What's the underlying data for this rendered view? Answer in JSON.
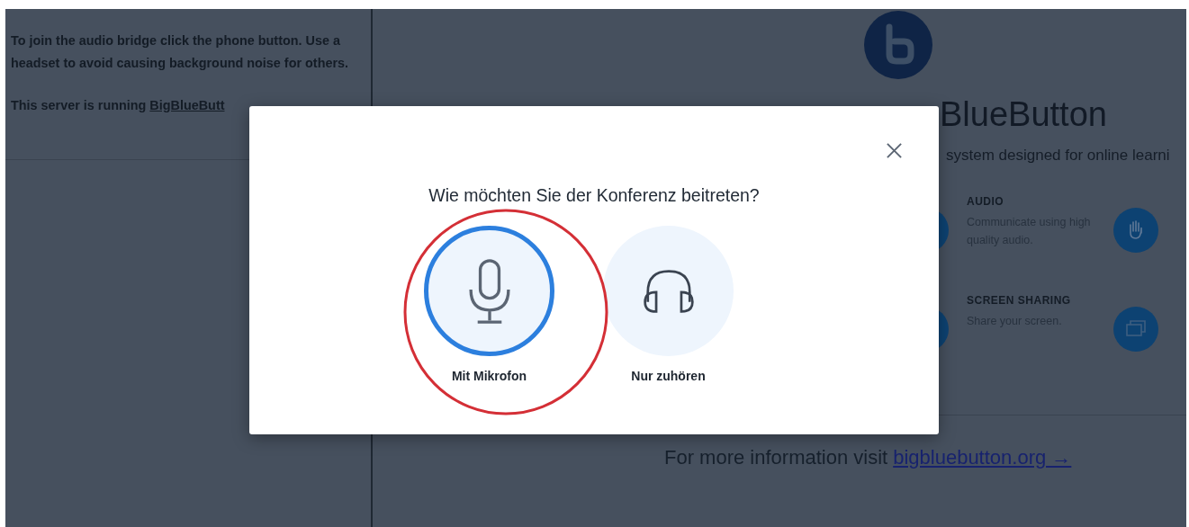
{
  "sidebar": {
    "paragraphs": [
      "To join the audio bridge click the phone button. Use a headset to avoid causing background noise for others."
    ],
    "server_text": "This server is running",
    "server_link": "BigBlueButt"
  },
  "welcome": {
    "title": "BlueButton",
    "subtitle": "system designed for online learni",
    "features": [
      {
        "title": "AUDIO",
        "text": "Communicate using high quality audio."
      },
      {
        "title": "SCREEN SHARING",
        "text": "Share your screen."
      }
    ],
    "side_icons": [
      {
        "kind": "hand"
      },
      {
        "kind": "screen"
      }
    ],
    "footer_text": "For more information visit",
    "footer_link": "bigbluebutton.org →"
  },
  "modal": {
    "question": "Wie möchten Sie der Konferenz beitreten?",
    "options": [
      {
        "label": "Mit Mikrofon",
        "kind": "microphone",
        "selected": true
      },
      {
        "label": "Nur zuhören",
        "kind": "headphones",
        "selected": false
      }
    ],
    "highlighted": true
  }
}
